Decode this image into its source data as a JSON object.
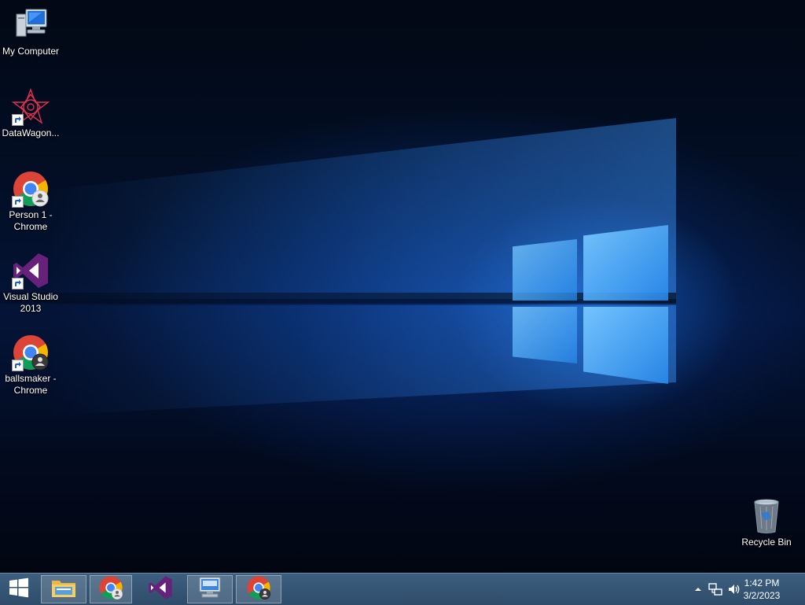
{
  "desktop": {
    "icons": [
      {
        "label": "My Computer",
        "icon": "computer-icon"
      },
      {
        "label": "DataWagon...",
        "icon": "datawagon-icon"
      },
      {
        "label": "Person 1 - Chrome",
        "icon": "chrome-icon"
      },
      {
        "label": "Visual Studio 2013",
        "icon": "visual-studio-icon"
      },
      {
        "label": "ballsmaker - Chrome",
        "icon": "chrome-icon"
      },
      {
        "label": "Recycle Bin",
        "icon": "recycle-bin-icon"
      }
    ]
  },
  "taskbar": {
    "start_icon": "windows-logo-icon",
    "pinned": [
      {
        "name": "File Explorer",
        "icon": "file-explorer-icon"
      },
      {
        "name": "Chrome (Person 1)",
        "icon": "chrome-icon"
      },
      {
        "name": "Visual Studio 2013",
        "icon": "visual-studio-icon"
      },
      {
        "name": "On-Screen Keyboard",
        "icon": "keyboard-monitor-icon"
      },
      {
        "name": "Chrome (ballsmaker)",
        "icon": "chrome-icon"
      }
    ],
    "tray": {
      "show_hidden_icon": "chevron-up-icon",
      "network_icon": "network-icon",
      "volume_icon": "speaker-icon",
      "time": "1:42 PM",
      "date": "3/2/2023"
    }
  },
  "colors": {
    "taskbar": "#2e4c6a",
    "wallpaper_dark": "#020814",
    "wallpaper_blue": "#1e78e6",
    "vs_purple": "#68217a"
  }
}
